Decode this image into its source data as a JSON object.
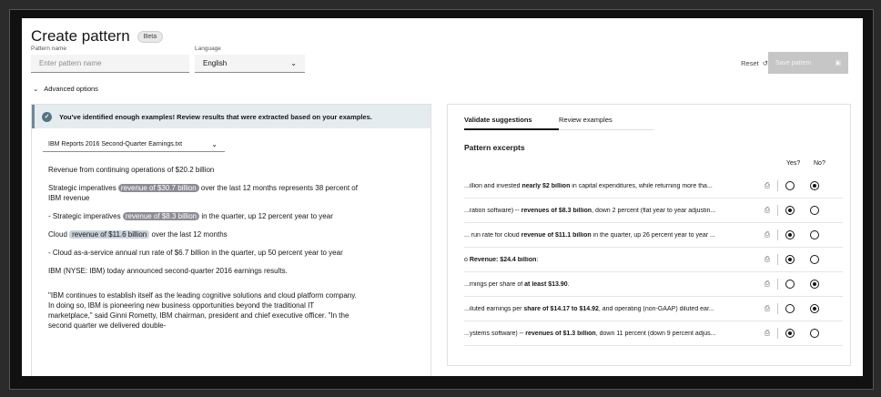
{
  "header": {
    "title": "Create pattern",
    "badge": "Beta"
  },
  "form": {
    "pattern_name_label": "Pattern name",
    "pattern_name_placeholder": "Enter pattern name",
    "language_label": "Language",
    "language_value": "English"
  },
  "actions": {
    "reset_label": "Reset",
    "save_label": "Save pattern"
  },
  "advanced_label": "Advanced options",
  "left": {
    "notice": "You've identified enough examples! Review results that were extracted based on your examples.",
    "file": "IBM Reports 2016 Second-Quarter Earnings.txt",
    "doc": {
      "p1": "Revenue from continuing operations of $20.2 billion",
      "p2_pre": "Strategic imperatives ",
      "p2_hl": "revenue of $30.7 billion",
      "p2_post": " over the last 12 months represents 38 percent of IBM revenue",
      "p3_pre": "- Strategic imperatives ",
      "p3_hl": "revenue of $8.3 billion",
      "p3_post": " in the quarter, up 12 percent year to year",
      "p4_pre": "Cloud ",
      "p4_hl": "revenue of $11.6 billion",
      "p4_post": " over the last 12 months",
      "p5": "- Cloud as-a-service annual run rate of $6.7 billion in the quarter, up 50 percent year to year",
      "p6": "IBM (NYSE: IBM) today announced second-quarter 2016 earnings results.",
      "p7": "\"IBM continues to establish itself as the leading cognitive solutions and cloud platform company. In doing so, IBM is pioneering new business opportunities beyond the traditional IT marketplace,\" said Ginni Rometty, IBM chairman, president and chief executive officer. \"In the second quarter we delivered double-"
    }
  },
  "right": {
    "tabs": [
      "Validate suggestions",
      "Review examples"
    ],
    "section_title": "Pattern excerpts",
    "yes_label": "Yes?",
    "no_label": "No?",
    "rows": [
      {
        "pre": "...illion and invested ",
        "bold": "nearly $2 billion",
        "post": " in capital expenditures, while returning more tha...",
        "choice": "no"
      },
      {
        "pre": "...ration software) -- ",
        "bold": "revenues of $8.3 billion",
        "post": ", down 2 percent (flat year to year adjustin...",
        "choice": "yes"
      },
      {
        "pre": "... run rate for cloud ",
        "bold": "revenue of $11.1 billion",
        "post": " in the quarter, up 26 percent year to year ...",
        "choice": "yes"
      },
      {
        "pre": "o ",
        "bold": "Revenue: $24.4 billion",
        "post": ":",
        "choice": "yes"
      },
      {
        "pre": "...rnings per share of ",
        "bold": "at least $13.90",
        "post": ".",
        "choice": "no"
      },
      {
        "pre": "...iluted earnings per ",
        "bold": "share of $14.17 to $14.92",
        "post": ", and operating (non-GAAP) diluted ear...",
        "choice": "no"
      },
      {
        "pre": "...ystems software) -- ",
        "bold": "revenues of $1.3 billion",
        "post": ", down 11 percent (down 9 percent adjus...",
        "choice": "yes"
      }
    ]
  }
}
